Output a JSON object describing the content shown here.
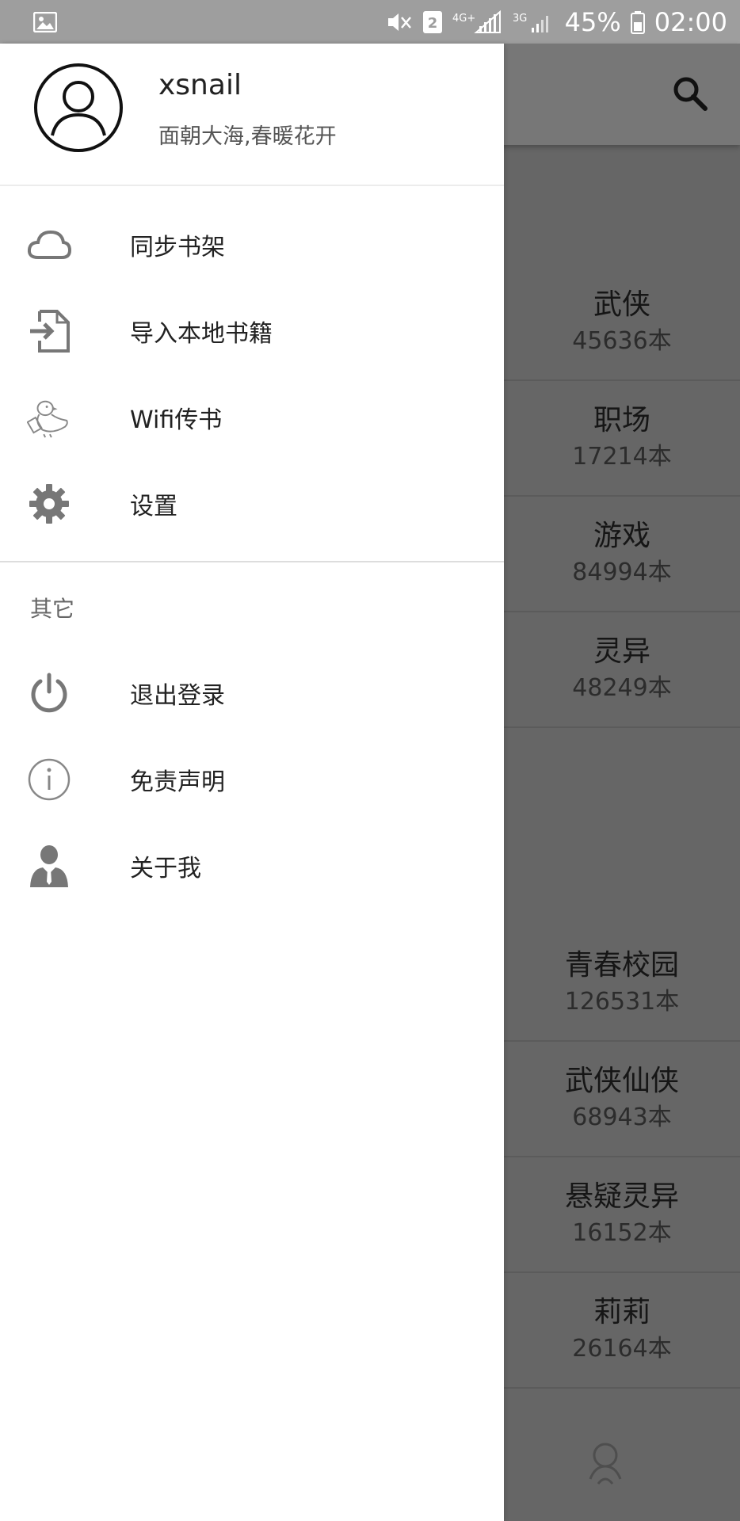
{
  "status_bar": {
    "left_icons": [
      "image-icon"
    ],
    "right_icons": [
      "mute-icon",
      "sim2-icon",
      "4g-icon",
      "signal-icon",
      "3g-icon",
      "signal-weak-icon",
      "battery-icon"
    ],
    "network_4g": "4G+",
    "network_3g": "3G",
    "sim_badge": "2",
    "battery": "45%",
    "time": "02:00"
  },
  "drawer": {
    "header": {
      "username": "xsnail",
      "motto": "面朝大海,春暖花开"
    },
    "main_items": [
      {
        "label": "同步书架",
        "icon": "cloud-icon"
      },
      {
        "label": "导入本地书籍",
        "icon": "import-file-icon"
      },
      {
        "label": "Wifi传书",
        "icon": "duck-icon"
      },
      {
        "label": "设置",
        "icon": "gear-icon"
      }
    ],
    "other_section_title": "其它",
    "other_items": [
      {
        "label": "退出登录",
        "icon": "power-icon"
      },
      {
        "label": "免责声明",
        "icon": "info-icon"
      },
      {
        "label": "关于我",
        "icon": "person-icon"
      }
    ]
  },
  "background": {
    "categories": [
      {
        "name": "武侠",
        "count": "45636本"
      },
      {
        "name": "职场",
        "count": "17214本"
      },
      {
        "name": "游戏",
        "count": "84994本"
      },
      {
        "name": "灵异",
        "count": "48249本"
      },
      {
        "name": "青春校园",
        "count": "126531本"
      },
      {
        "name": "武侠仙侠",
        "count": "68943本"
      },
      {
        "name": "悬疑灵异",
        "count": "16152本"
      },
      {
        "name": "莉莉",
        "count": "26164本"
      }
    ]
  },
  "colors": {
    "status_bar": "#9e9e9e",
    "scrim": "#666666",
    "drawer_bg": "#ffffff",
    "text_primary": "#222222",
    "text_secondary": "#555555"
  }
}
